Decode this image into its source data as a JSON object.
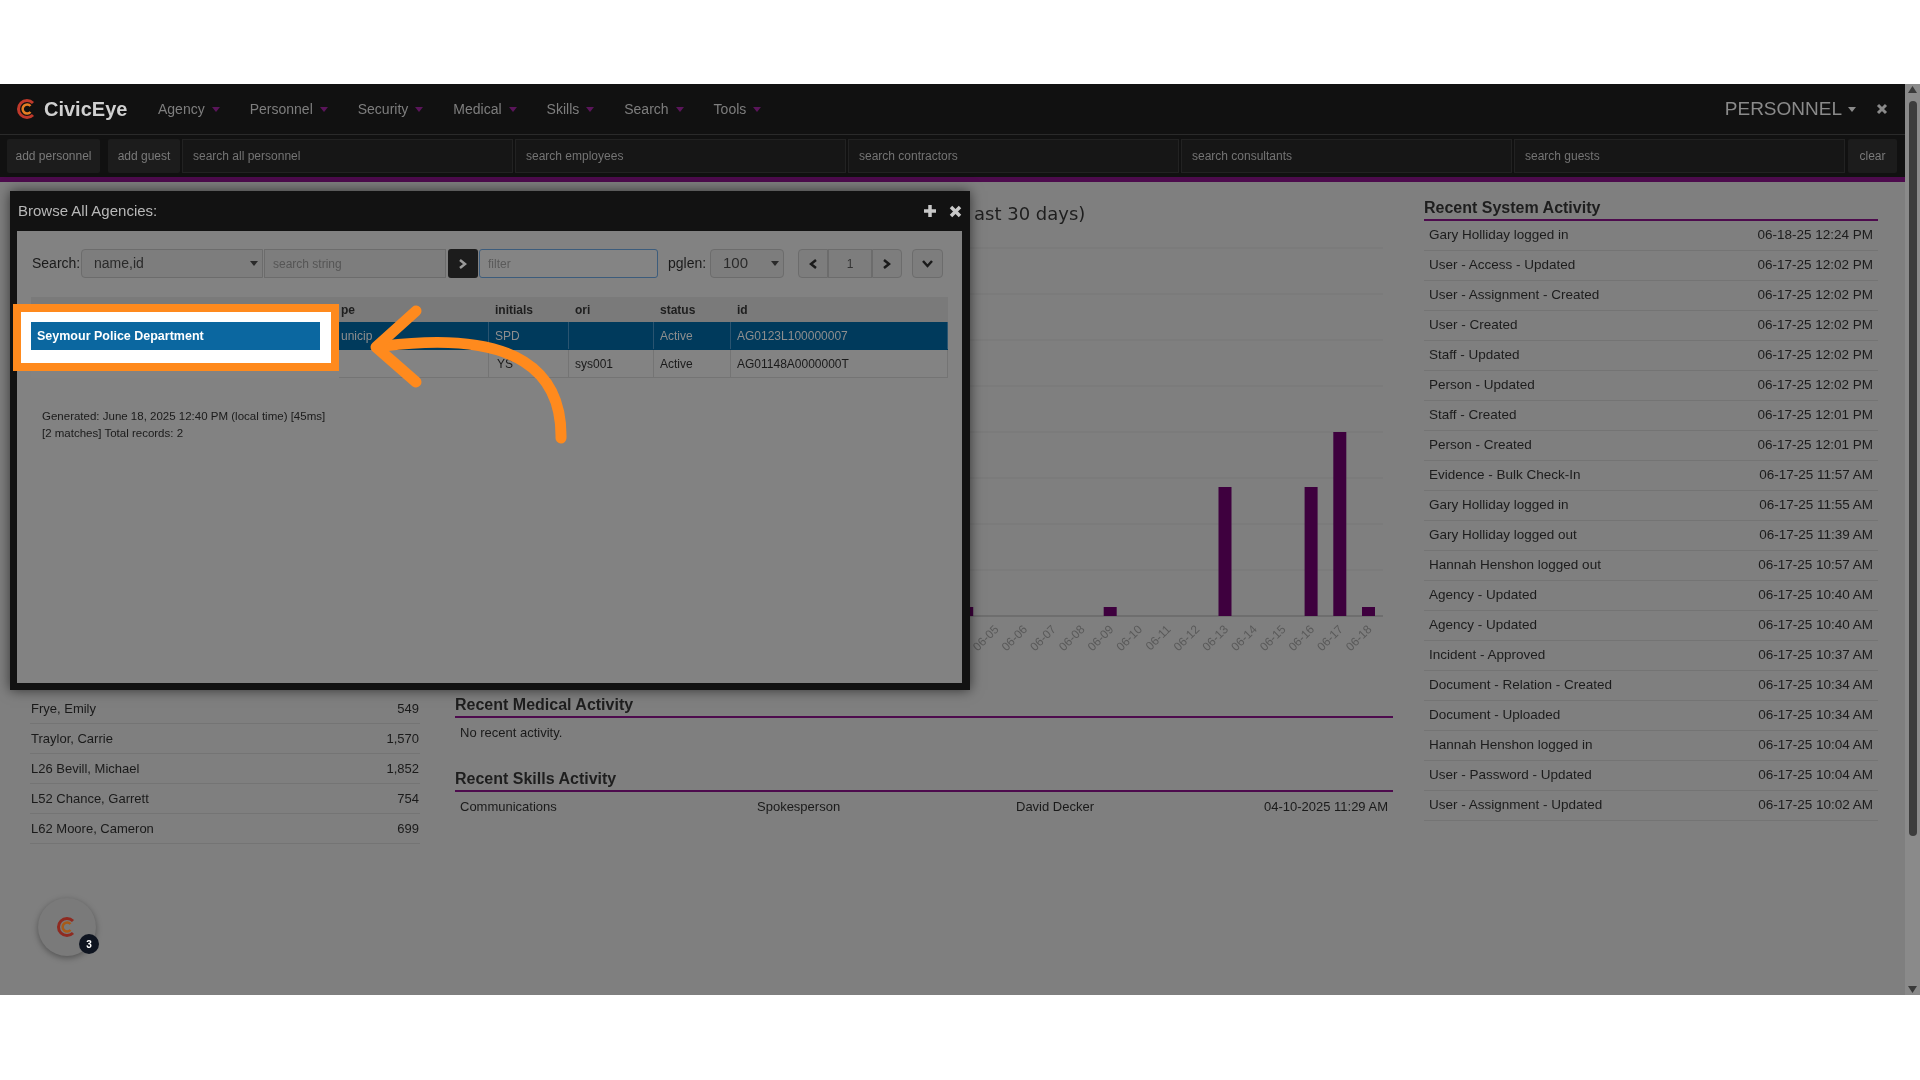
{
  "nav": {
    "brand": "CivicEye",
    "menus": [
      {
        "label": "Agency"
      },
      {
        "label": "Personnel"
      },
      {
        "label": "Security"
      },
      {
        "label": "Medical"
      },
      {
        "label": "Skills"
      },
      {
        "label": "Search"
      },
      {
        "label": "Tools"
      }
    ],
    "module": "PERSONNEL"
  },
  "toolbar": {
    "buttons": [
      "add personnel",
      "add guest"
    ],
    "searches": [
      {
        "placeholder": "search all personnel"
      },
      {
        "placeholder": "search employees"
      },
      {
        "placeholder": "search contractors"
      },
      {
        "placeholder": "search consultants"
      },
      {
        "placeholder": "search guests"
      }
    ],
    "clear": "clear"
  },
  "chart": {
    "title": "ast 30 days)",
    "x_labels": [
      "06-05",
      "06-06",
      "06-07",
      "06-08",
      "06-09",
      "06-10",
      "06-11",
      "06-12",
      "06-13",
      "06-14",
      "06-15",
      "06-16",
      "06-17",
      "06-18"
    ]
  },
  "top_list": [
    {
      "name": "Frye, Emily",
      "value": "549"
    },
    {
      "name": "Traylor, Carrie",
      "value": "1,570"
    },
    {
      "name": "L26 Bevill, Michael",
      "value": "1,852"
    },
    {
      "name": "L52 Chance, Garrett",
      "value": "754"
    },
    {
      "name": "L62 Moore, Cameron",
      "value": "699"
    }
  ],
  "medical": {
    "title": "Recent Medical Activity",
    "empty_text": "No recent activity."
  },
  "skills": {
    "title": "Recent Skills Activity",
    "rows": [
      {
        "skill": "Communications",
        "role": "Spokesperson",
        "person": "David Decker",
        "date": "04-10-2025 11:29 AM"
      }
    ]
  },
  "system_activity": {
    "title": "Recent System Activity",
    "rows": [
      {
        "event": "Gary Holliday logged in",
        "time": "06-18-25 12:24 PM"
      },
      {
        "event": "User - Access - Updated",
        "time": "06-17-25 12:02 PM"
      },
      {
        "event": "User - Assignment - Created",
        "time": "06-17-25 12:02 PM"
      },
      {
        "event": "User - Created",
        "time": "06-17-25 12:02 PM"
      },
      {
        "event": "Staff - Updated",
        "time": "06-17-25 12:02 PM"
      },
      {
        "event": "Person - Updated",
        "time": "06-17-25 12:02 PM"
      },
      {
        "event": "Staff - Created",
        "time": "06-17-25 12:01 PM"
      },
      {
        "event": "Person - Created",
        "time": "06-17-25 12:01 PM"
      },
      {
        "event": "Evidence - Bulk Check-In",
        "time": "06-17-25 11:57 AM"
      },
      {
        "event": "Gary Holliday logged in",
        "time": "06-17-25 11:55 AM"
      },
      {
        "event": "Gary Holliday logged out",
        "time": "06-17-25 11:39 AM"
      },
      {
        "event": "Hannah Henshon logged out",
        "time": "06-17-25 10:57 AM"
      },
      {
        "event": "Agency - Updated",
        "time": "06-17-25 10:40 AM"
      },
      {
        "event": "Agency - Updated",
        "time": "06-17-25 10:40 AM"
      },
      {
        "event": "Incident - Approved",
        "time": "06-17-25 10:37 AM"
      },
      {
        "event": "Document - Relation - Created",
        "time": "06-17-25 10:34 AM"
      },
      {
        "event": "Document - Uploaded",
        "time": "06-17-25 10:34 AM"
      },
      {
        "event": "Hannah Henshon logged in",
        "time": "06-17-25 10:04 AM"
      },
      {
        "event": "User - Password - Updated",
        "time": "06-17-25 10:04 AM"
      },
      {
        "event": "User - Assignment - Updated",
        "time": "06-17-25 10:02 AM"
      }
    ]
  },
  "help_button": {
    "badge": "3"
  },
  "modal": {
    "title": "Browse All Agencies:",
    "search_label": "Search:",
    "search_by": "name,id",
    "search_placeholder": "search string",
    "filter_placeholder": "filter",
    "pglen_label": "pglen:",
    "pglen": "100",
    "page": "1",
    "columns": [
      "pe",
      "initials",
      "ori",
      "status",
      "id"
    ],
    "rows": [
      {
        "selected": true,
        "name": "Seymour Police Department",
        "type": "unicip",
        "initials": "SPD",
        "status": "Active",
        "id": "AG0123L100000007"
      },
      {
        "selected": false,
        "initials": "YS",
        "ori": "sys001",
        "status": "Active",
        "id": "AG01148A0000000T"
      }
    ],
    "generated": "Generated: June 18, 2025 12:40 PM (local time) [45ms]",
    "matches": "[2 matches] Total records: 2"
  }
}
